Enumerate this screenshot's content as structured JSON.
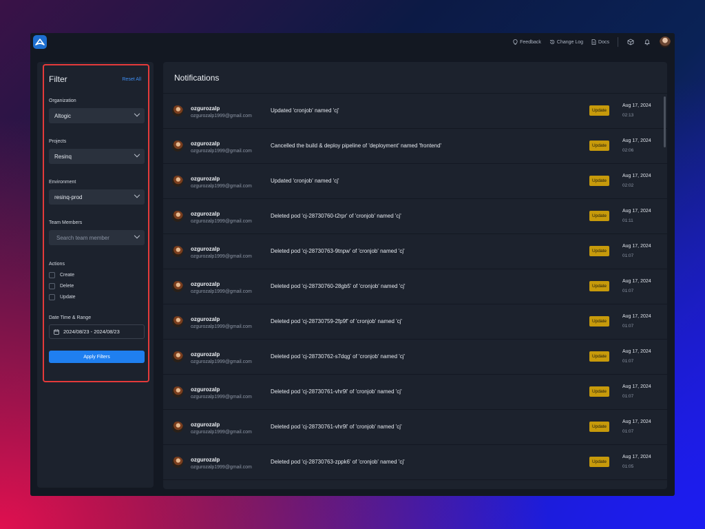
{
  "topbar": {
    "links": [
      {
        "label": "Feedback",
        "icon": "feedback-icon"
      },
      {
        "label": "Change Log",
        "icon": "history-icon"
      },
      {
        "label": "Docs",
        "icon": "document-icon"
      }
    ]
  },
  "filter": {
    "title": "Filter",
    "reset_label": "Reset All",
    "organization": {
      "label": "Organization",
      "value": "Altogic"
    },
    "projects": {
      "label": "Projects",
      "value": "Resinq"
    },
    "environment": {
      "label": "Environment",
      "value": "resinq-prod"
    },
    "team_members": {
      "label": "Team Members",
      "placeholder": "Search team member"
    },
    "actions": {
      "label": "Actions",
      "options": [
        "Create",
        "Delete",
        "Update"
      ]
    },
    "date_range": {
      "label": "Date Time & Range",
      "value": "2024/08/23 - 2024/08/23"
    },
    "apply_label": "Apply Filters"
  },
  "notifications": {
    "title": "Notifications",
    "items": [
      {
        "user": "ozgurozalp",
        "email": "ozgurozalp1999@gmail.com",
        "message": "Updated 'cronjob' named 'cj'",
        "badge": "Update",
        "date": "Aug 17, 2024",
        "time": "02:13"
      },
      {
        "user": "ozgurozalp",
        "email": "ozgurozalp1999@gmail.com",
        "message": "Cancelled the build & deploy pipeline of 'deployment' named 'frontend'",
        "badge": "Update",
        "date": "Aug 17, 2024",
        "time": "02:06"
      },
      {
        "user": "ozgurozalp",
        "email": "ozgurozalp1999@gmail.com",
        "message": "Updated 'cronjob' named 'cj'",
        "badge": "Update",
        "date": "Aug 17, 2024",
        "time": "02:02"
      },
      {
        "user": "ozgurozalp",
        "email": "ozgurozalp1999@gmail.com",
        "message": "Deleted pod 'cj-28730760-t2rpr' of 'cronjob' named 'cj'",
        "badge": "Update",
        "date": "Aug 17, 2024",
        "time": "01:11"
      },
      {
        "user": "ozgurozalp",
        "email": "ozgurozalp1999@gmail.com",
        "message": "Deleted pod 'cj-28730763-9tnpw' of 'cronjob' named 'cj'",
        "badge": "Update",
        "date": "Aug 17, 2024",
        "time": "01:07"
      },
      {
        "user": "ozgurozalp",
        "email": "ozgurozalp1999@gmail.com",
        "message": "Deleted pod 'cj-28730760-28gb5' of 'cronjob' named 'cj'",
        "badge": "Update",
        "date": "Aug 17, 2024",
        "time": "01:07"
      },
      {
        "user": "ozgurozalp",
        "email": "ozgurozalp1999@gmail.com",
        "message": "Deleted pod 'cj-28730759-2fp9f' of 'cronjob' named 'cj'",
        "badge": "Update",
        "date": "Aug 17, 2024",
        "time": "01:07"
      },
      {
        "user": "ozgurozalp",
        "email": "ozgurozalp1999@gmail.com",
        "message": "Deleted pod 'cj-28730762-s7dqg' of 'cronjob' named 'cj'",
        "badge": "Update",
        "date": "Aug 17, 2024",
        "time": "01:07"
      },
      {
        "user": "ozgurozalp",
        "email": "ozgurozalp1999@gmail.com",
        "message": "Deleted pod 'cj-28730761-vhr9l' of 'cronjob' named 'cj'",
        "badge": "Update",
        "date": "Aug 17, 2024",
        "time": "01:07"
      },
      {
        "user": "ozgurozalp",
        "email": "ozgurozalp1999@gmail.com",
        "message": "Deleted pod 'cj-28730761-vhr9l' of 'cronjob' named 'cj'",
        "badge": "Update",
        "date": "Aug 17, 2024",
        "time": "01:07"
      },
      {
        "user": "ozgurozalp",
        "email": "ozgurozalp1999@gmail.com",
        "message": "Deleted pod 'cj-28730763-zppk6' of 'cronjob' named 'cj'",
        "badge": "Update",
        "date": "Aug 17, 2024",
        "time": "01:05"
      }
    ]
  },
  "colors": {
    "accent": "#1f7ff0",
    "badge": "#c79a0b",
    "highlight_border": "#e53a3a",
    "panel_bg": "#1c222d"
  }
}
